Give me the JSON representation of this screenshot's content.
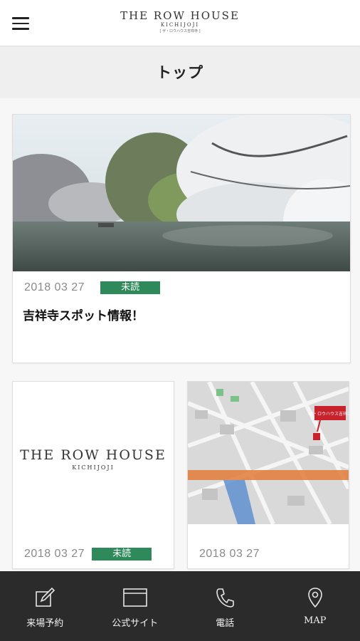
{
  "header": {
    "logo_line1": "THE ROW HOUSE",
    "logo_line2": "KICHIJOJI",
    "logo_line3": "[ ザ・ロウハウス吉祥寺 ]"
  },
  "page": {
    "title": "トップ"
  },
  "cards": [
    {
      "date": "2018 03 27",
      "badge": "未読",
      "title": "吉祥寺スポット情報！",
      "image": "cherry-blossom-photo"
    },
    {
      "date": "2018 03 27",
      "badge": "未読",
      "logo_line1": "THE ROW HOUSE",
      "logo_line2": "KICHIJOJI"
    },
    {
      "date": "2018 03 27",
      "image": "area-map",
      "map_label": "ザ・ロウハウス吉祥寺"
    }
  ],
  "tabbar": {
    "items": [
      {
        "label": "来場予約",
        "icon": "edit-icon"
      },
      {
        "label": "公式サイト",
        "icon": "browser-icon"
      },
      {
        "label": "電話",
        "icon": "phone-icon"
      },
      {
        "label": "MAP",
        "icon": "map-pin-icon"
      }
    ]
  },
  "colors": {
    "accent": "#2e8a5a",
    "tabbar": "#2b2b2b"
  }
}
